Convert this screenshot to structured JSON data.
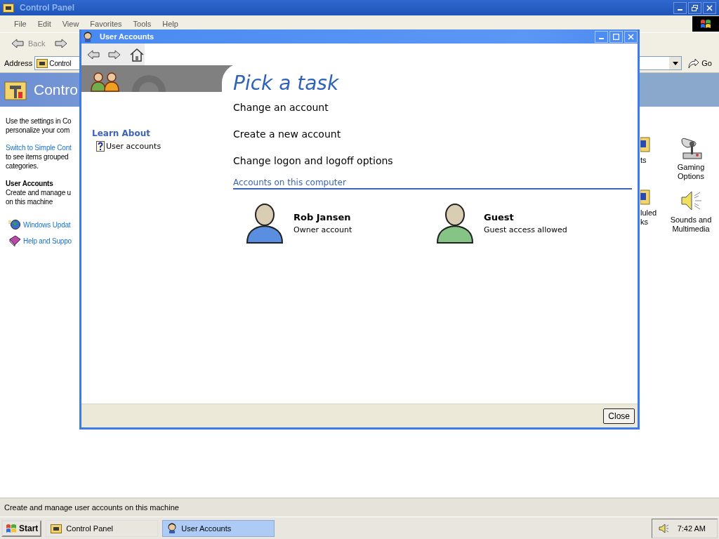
{
  "control_panel": {
    "title": "Control Panel",
    "menu": [
      "File",
      "Edit",
      "View",
      "Favorites",
      "Tools",
      "Help"
    ],
    "toolbar": {
      "back": "Back"
    },
    "address": {
      "label": "Address",
      "value": "Control",
      "go": "Go"
    },
    "header": "Contro",
    "left_pane": {
      "intro_lines": [
        "Use the settings in Co",
        "personalize your com"
      ],
      "link": "Switch to Simple Cont",
      "link_lines": [
        "to see items grouped",
        "categories."
      ],
      "selected_title": "User Accounts",
      "selected_lines": [
        "Create and manage u",
        "on this machine"
      ],
      "see_also": [
        {
          "kind": "update",
          "label": "Windows Updat"
        },
        {
          "kind": "help",
          "label": "Help and Suppo"
        }
      ]
    },
    "items": [
      {
        "kind": "cut",
        "label_lines": [
          "ts"
        ]
      },
      {
        "kind": "gaming",
        "label_lines": [
          "Gaming",
          "Options"
        ]
      },
      {
        "kind": "cut",
        "label_lines": [
          "luled",
          "ks"
        ]
      },
      {
        "kind": "sound",
        "label_lines": [
          "Sounds and",
          "Multimedia"
        ]
      }
    ],
    "status_bar": "Create and manage user accounts on this machine"
  },
  "dialog": {
    "title": "User Accounts",
    "learn_about": {
      "title": "Learn About",
      "items": [
        "User accounts"
      ]
    },
    "heading": "Pick a task",
    "tasks": [
      "Change an account",
      "Create a new account",
      "Change logon and logoff options"
    ],
    "section": "Accounts on this computer",
    "accounts": [
      {
        "name": "Rob Jansen",
        "type": "Owner account",
        "color": "#5a8ee0"
      },
      {
        "name": "Guest",
        "type": "Guest access allowed",
        "color": "#86c486"
      }
    ],
    "close": "Close"
  },
  "taskbar": {
    "start": "Start",
    "buttons": [
      {
        "label": "Control Panel",
        "selected": false
      },
      {
        "label": "User Accounts",
        "selected": true
      }
    ],
    "clock": "7:42 AM"
  }
}
